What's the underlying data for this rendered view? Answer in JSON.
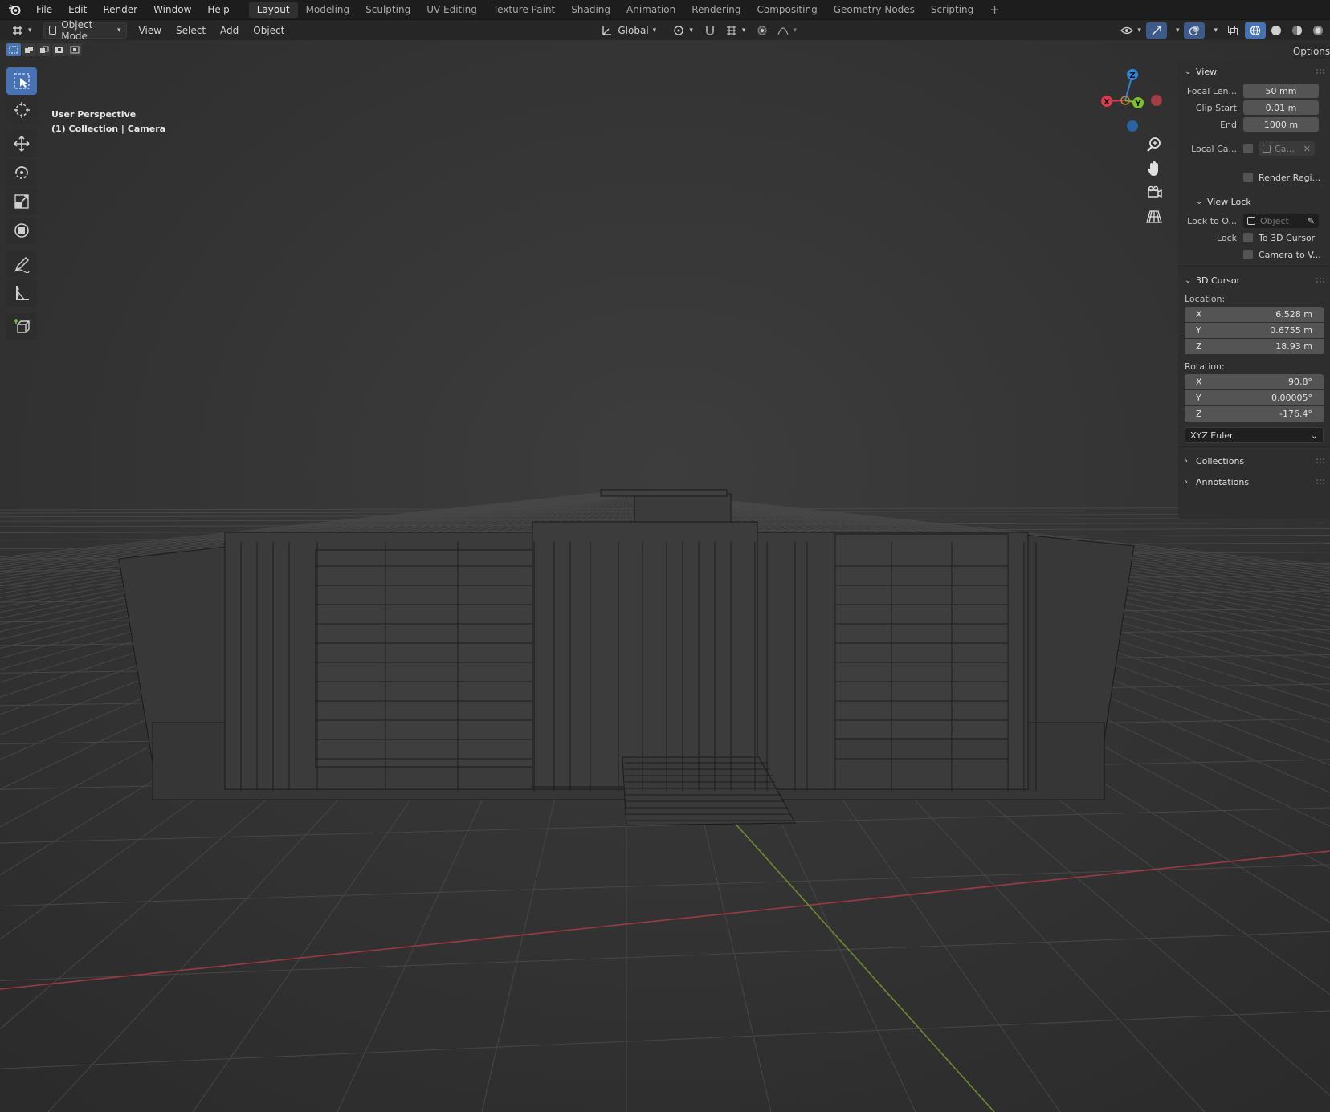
{
  "topbar": {
    "menus": [
      "File",
      "Edit",
      "Render",
      "Window",
      "Help"
    ],
    "workspaces": [
      "Layout",
      "Modeling",
      "Sculpting",
      "UV Editing",
      "Texture Paint",
      "Shading",
      "Animation",
      "Rendering",
      "Compositing",
      "Geometry Nodes",
      "Scripting"
    ],
    "active_workspace": "Layout",
    "add_workspace": "+"
  },
  "header": {
    "mode": "Object Mode",
    "menus": [
      "View",
      "Select",
      "Add",
      "Object"
    ],
    "orientation": "Global"
  },
  "options_label": "Options",
  "viewport": {
    "perspective": "User Perspective",
    "collection": "(1) Collection | Camera"
  },
  "gizmo": {
    "x": "X",
    "y": "Y",
    "z": "Z"
  },
  "colors": {
    "accent": "#4772b3",
    "x_axis": "#e0394f",
    "y_axis": "#7ec22b",
    "z_axis": "#2f85d8"
  },
  "sidebar": {
    "view": {
      "title": "View",
      "focal_length_label": "Focal Len...",
      "focal_length": "50 mm",
      "clip_start_label": "Clip Start",
      "clip_start": "0.01 m",
      "end_label": "End",
      "end": "1000 m",
      "local_camera_label": "Local Ca...",
      "local_camera_value": "Ca...",
      "render_region_label": "Render Regi..."
    },
    "view_lock": {
      "title": "View Lock",
      "lock_to_object_label": "Lock to O...",
      "lock_to_object_placeholder": "Object",
      "lock_label": "Lock",
      "to_3d_cursor": "To 3D Cursor",
      "camera_to_view": "Camera to V..."
    },
    "cursor": {
      "title": "3D Cursor",
      "location_label": "Location:",
      "location": [
        {
          "axis": "X",
          "value": "6.528 m"
        },
        {
          "axis": "Y",
          "value": "0.6755 m"
        },
        {
          "axis": "Z",
          "value": "18.93 m"
        }
      ],
      "rotation_label": "Rotation:",
      "rotation": [
        {
          "axis": "X",
          "value": "90.8°"
        },
        {
          "axis": "Y",
          "value": "0.00005°"
        },
        {
          "axis": "Z",
          "value": "-176.4°"
        }
      ],
      "rotation_mode": "XYZ Euler"
    },
    "collections": {
      "title": "Collections"
    },
    "annotations": {
      "title": "Annotations"
    }
  }
}
